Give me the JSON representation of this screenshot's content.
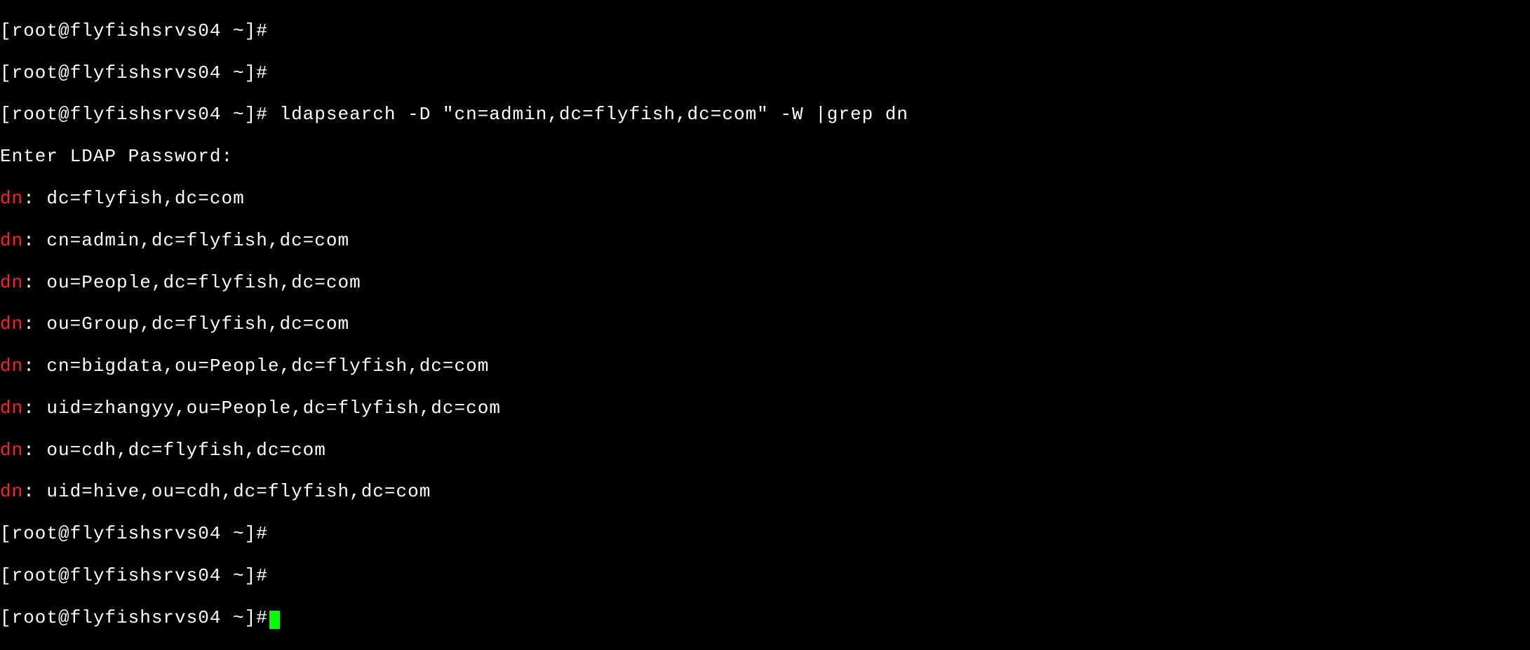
{
  "prompts": {
    "p1": "[root@flyfishsrvs04 ~]#",
    "p2": "[root@flyfishsrvs04 ~]#",
    "p3": "[root@flyfishsrvs04 ~]# ldapsearch -D \"cn=admin,dc=flyfish,dc=com\" -W |grep dn"
  },
  "password_prompt": "Enter LDAP Password:",
  "dn_label": "dn",
  "dn_values": {
    "v1": ": dc=flyfish,dc=com",
    "v2": ": cn=admin,dc=flyfish,dc=com",
    "v3": ": ou=People,dc=flyfish,dc=com",
    "v4": ": ou=Group,dc=flyfish,dc=com",
    "v5": ": cn=bigdata,ou=People,dc=flyfish,dc=com",
    "v6": ": uid=zhangyy,ou=People,dc=flyfish,dc=com",
    "v7": ": ou=cdh,dc=flyfish,dc=com",
    "v8": ": uid=hive,ou=cdh,dc=flyfish,dc=com"
  },
  "trailing_prompts": {
    "t1": "[root@flyfishsrvs04 ~]#",
    "t2": "[root@flyfishsrvs04 ~]#",
    "t3": "[root@flyfishsrvs04 ~]#"
  }
}
